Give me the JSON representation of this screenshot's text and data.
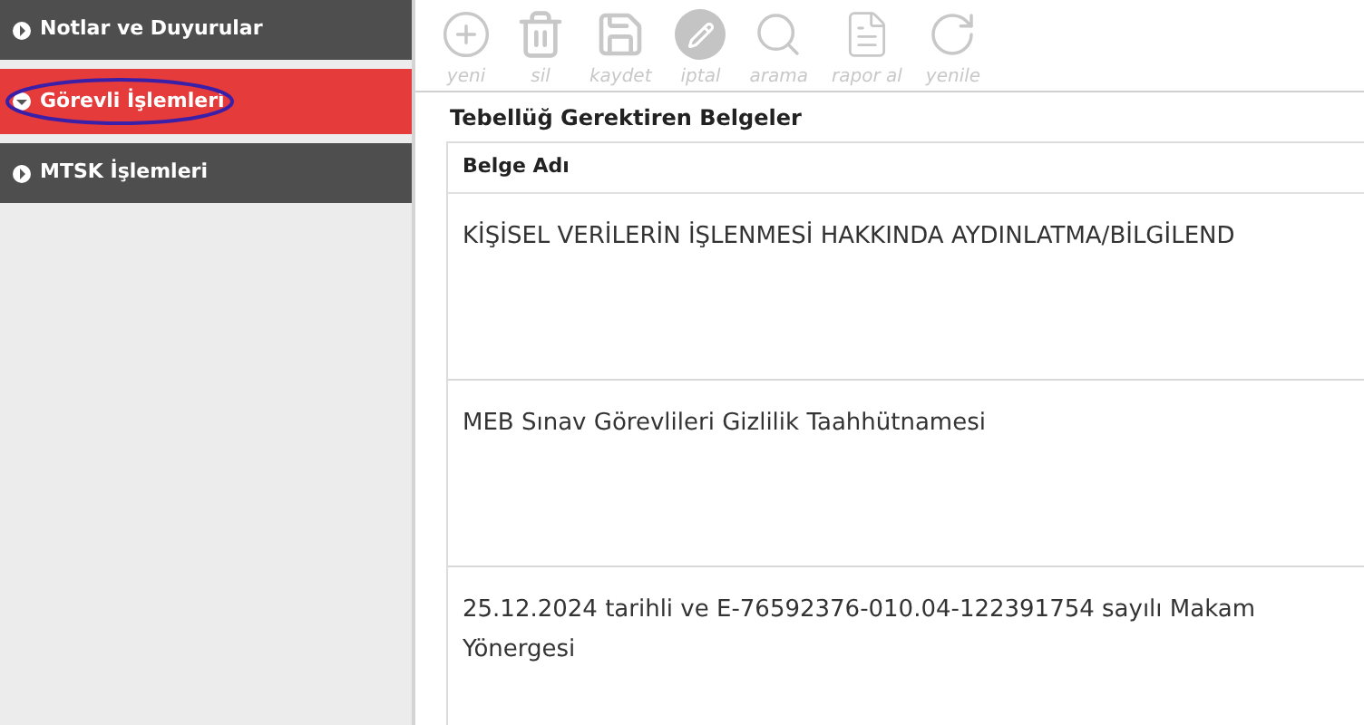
{
  "sidebar": {
    "items": [
      {
        "label": "Notlar ve Duyurular",
        "selected": false,
        "circled": false
      },
      {
        "label": "Görevli İşlemleri",
        "selected": true,
        "circled": true
      },
      {
        "label": "MTSK İşlemleri",
        "selected": false,
        "circled": false
      }
    ]
  },
  "toolbar": [
    {
      "kind": "new",
      "label": "yeni",
      "disabled": true
    },
    {
      "kind": "delete",
      "label": "sil",
      "disabled": true
    },
    {
      "kind": "save",
      "label": "kaydet",
      "disabled": true
    },
    {
      "kind": "cancel",
      "label": "iptal",
      "disabled": true
    },
    {
      "kind": "search",
      "label": "arama",
      "disabled": true
    },
    {
      "kind": "report",
      "label": "rapor al",
      "disabled": true
    },
    {
      "kind": "refresh",
      "label": "yenile",
      "disabled": true
    }
  ],
  "section_title": "Tebellüğ Gerektiren Belgeler",
  "table": {
    "columns": [
      "Belge Adı"
    ],
    "rows": [
      {
        "lines": [
          "KİŞİSEL VERİLERİN İŞLENMESİ HAKKINDA AYDINLATMA/BİLGİLEND"
        ]
      },
      {
        "lines": [
          "MEB Sınav Görevlileri Gizlilik Taahhütnamesi"
        ]
      },
      {
        "lines": [
          "25.12.2024 tarihli ve E-76592376-010.04-122391754 sayılı Makam",
          "Yönergesi"
        ]
      }
    ]
  }
}
